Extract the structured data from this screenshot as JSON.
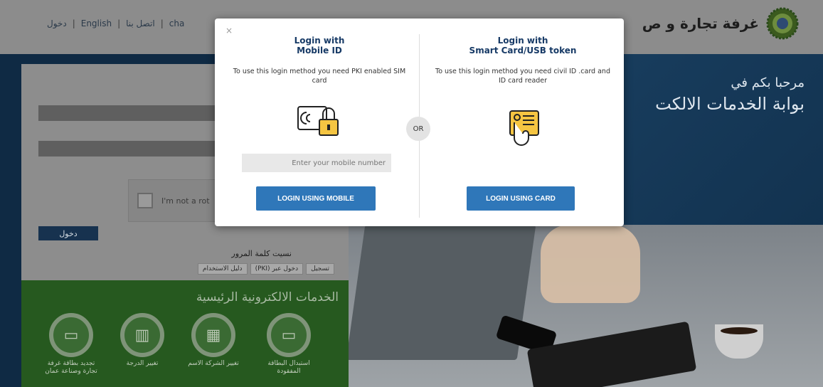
{
  "header": {
    "links": [
      "دخول",
      "English",
      "اتصل بنا",
      "cha"
    ],
    "brand_name": "غرفة تجارة و ص"
  },
  "hero": {
    "welcome_line1": "مرحبا بكم في",
    "welcome_line2": "بوابة الخدمات الالكت"
  },
  "login_panel": {
    "captcha_text": "I'm not a rot",
    "login_button": "دخول",
    "forgot_password": "نسيت كلمة المرور",
    "links": [
      "تسجيل",
      "(PKI) دخول عبر",
      "دليل الاستخدام"
    ]
  },
  "services": {
    "title": "الخدمات الالكترونية الرئيسية",
    "items": [
      {
        "label": "تجديد بطاقة غرفة تجارة وصناعة عمان",
        "icon": "card-renew-icon"
      },
      {
        "label": "تغيير الدرجة",
        "icon": "grade-change-icon"
      },
      {
        "label": "تغيير الشركة الاسم",
        "icon": "company-change-icon"
      },
      {
        "label": "استبدال البطاقة المفقودة",
        "icon": "card-replace-icon"
      }
    ]
  },
  "modal": {
    "close_label": "×",
    "or_label": "OR",
    "mobile": {
      "title_line1": "Login with",
      "title_line2": "Mobile ID",
      "description": "To use this login method you need PKI enabled SIM card",
      "input_placeholder": "Enter your mobile number",
      "button_label": "LOGIN USING MOBILE"
    },
    "card": {
      "title_line1": "Login with",
      "title_line2": "Smart Card/USB token",
      "description": "To use this login method you need civil ID .card and ID card reader",
      "button_label": "LOGIN USING CARD"
    },
    "accent_color": "#2f77b9",
    "title_color": "#173a66"
  }
}
